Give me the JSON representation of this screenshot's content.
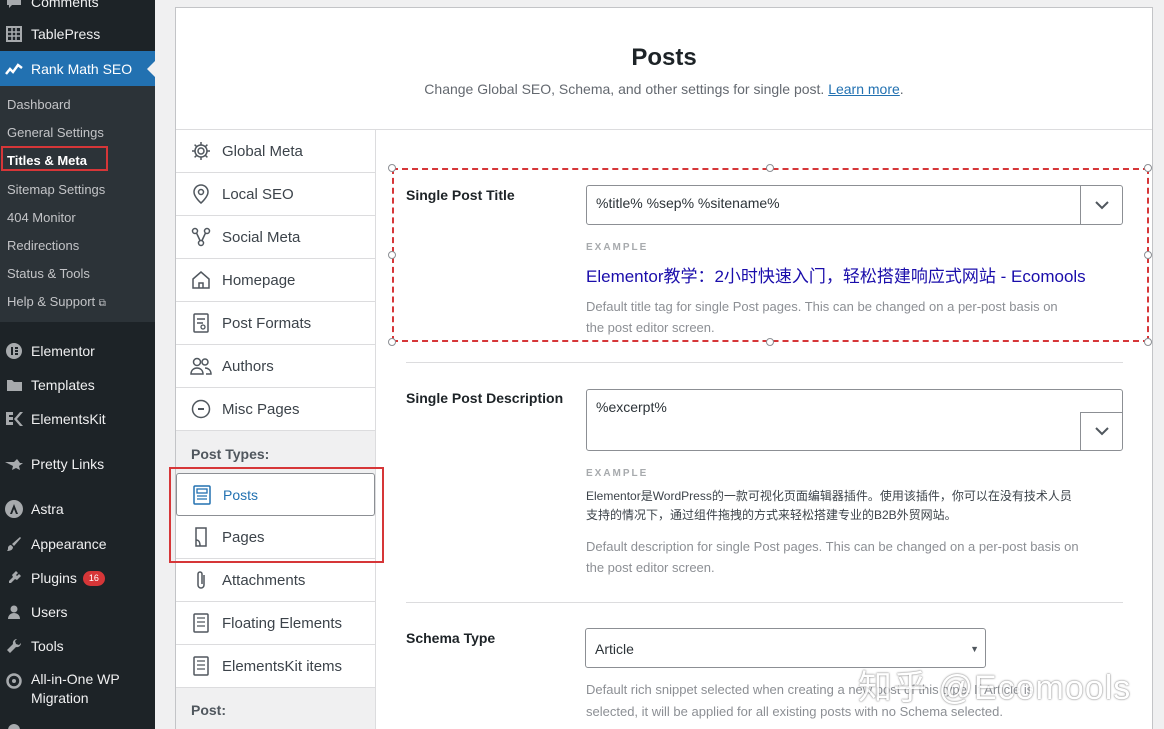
{
  "admin_menu": {
    "items": [
      {
        "label": "Comments",
        "icon": "comments-icon"
      },
      {
        "label": "TablePress",
        "icon": "table-icon"
      },
      {
        "label": "Rank Math SEO",
        "icon": "rank-math-icon"
      },
      {
        "label": "Elementor",
        "icon": "elementor-icon"
      },
      {
        "label": "Templates",
        "icon": "folder-icon"
      },
      {
        "label": "ElementsKit",
        "icon": "elementskit-icon"
      },
      {
        "label": "Pretty Links",
        "icon": "star-link-icon"
      },
      {
        "label": "Astra",
        "icon": "astra-icon"
      },
      {
        "label": "Appearance",
        "icon": "brush-icon"
      },
      {
        "label": "Plugins",
        "icon": "plugin-icon",
        "badge": "16"
      },
      {
        "label": "Users",
        "icon": "user-icon"
      },
      {
        "label": "Tools",
        "icon": "wrench-icon"
      },
      {
        "label": "All-in-One WP",
        "label2": "Migration",
        "icon": "migration-icon"
      }
    ],
    "submenu": [
      "Dashboard",
      "General Settings",
      "Titles & Meta",
      "Sitemap Settings",
      "404 Monitor",
      "Redirections",
      "Status & Tools",
      "Help & Support"
    ],
    "active_submenu": "Titles & Meta"
  },
  "header": {
    "title": "Posts",
    "subtitle": "Change Global SEO, Schema, and other settings for single post.",
    "learn_more": "Learn more",
    "period": "."
  },
  "tabs": {
    "items": [
      "Global Meta",
      "Local SEO",
      "Social Meta",
      "Homepage",
      "Post Formats",
      "Authors",
      "Misc Pages"
    ],
    "group_post_types": "Post Types:",
    "post_types": [
      "Posts",
      "Pages",
      "Attachments",
      "Floating Elements",
      "ElementsKit items"
    ],
    "selected": "Posts",
    "group_post": "Post:"
  },
  "fields": {
    "title_label": "Single Post Title",
    "title_value": "%title% %sep% %sitename%",
    "example_label": "EXAMPLE",
    "title_example": "Elementor教学：2小时快速入门，轻松搭建响应式网站 - Ecomools",
    "title_desc_1": "Default title tag for single Post pages. This can be changed on a per-post basis on",
    "title_desc_2": "the post editor screen.",
    "desc_label": "Single Post Description",
    "desc_value": "%excerpt%",
    "desc_example_1": "Elementor是WordPress的一款可视化页面编辑器插件。使用该插件，你可以在没有技术人员",
    "desc_example_2": "支持的情况下，通过组件拖拽的方式来轻松搭建专业的B2B外贸网站。",
    "desc_desc_1": "Default description for single Post pages. This can be changed on a per-post basis on",
    "desc_desc_2": "the post editor screen.",
    "schema_label": "Schema Type",
    "schema_value": "Article",
    "schema_desc_1": "Default rich snippet selected when creating a new post of this type. If Article is",
    "schema_desc_2": "selected, it will be applied for all existing posts with no Schema selected."
  },
  "watermark": "知乎 @Ecomools",
  "colors": {
    "accent": "#2271b1",
    "highlight": "#d63638",
    "menu_bg": "#1d2327"
  }
}
